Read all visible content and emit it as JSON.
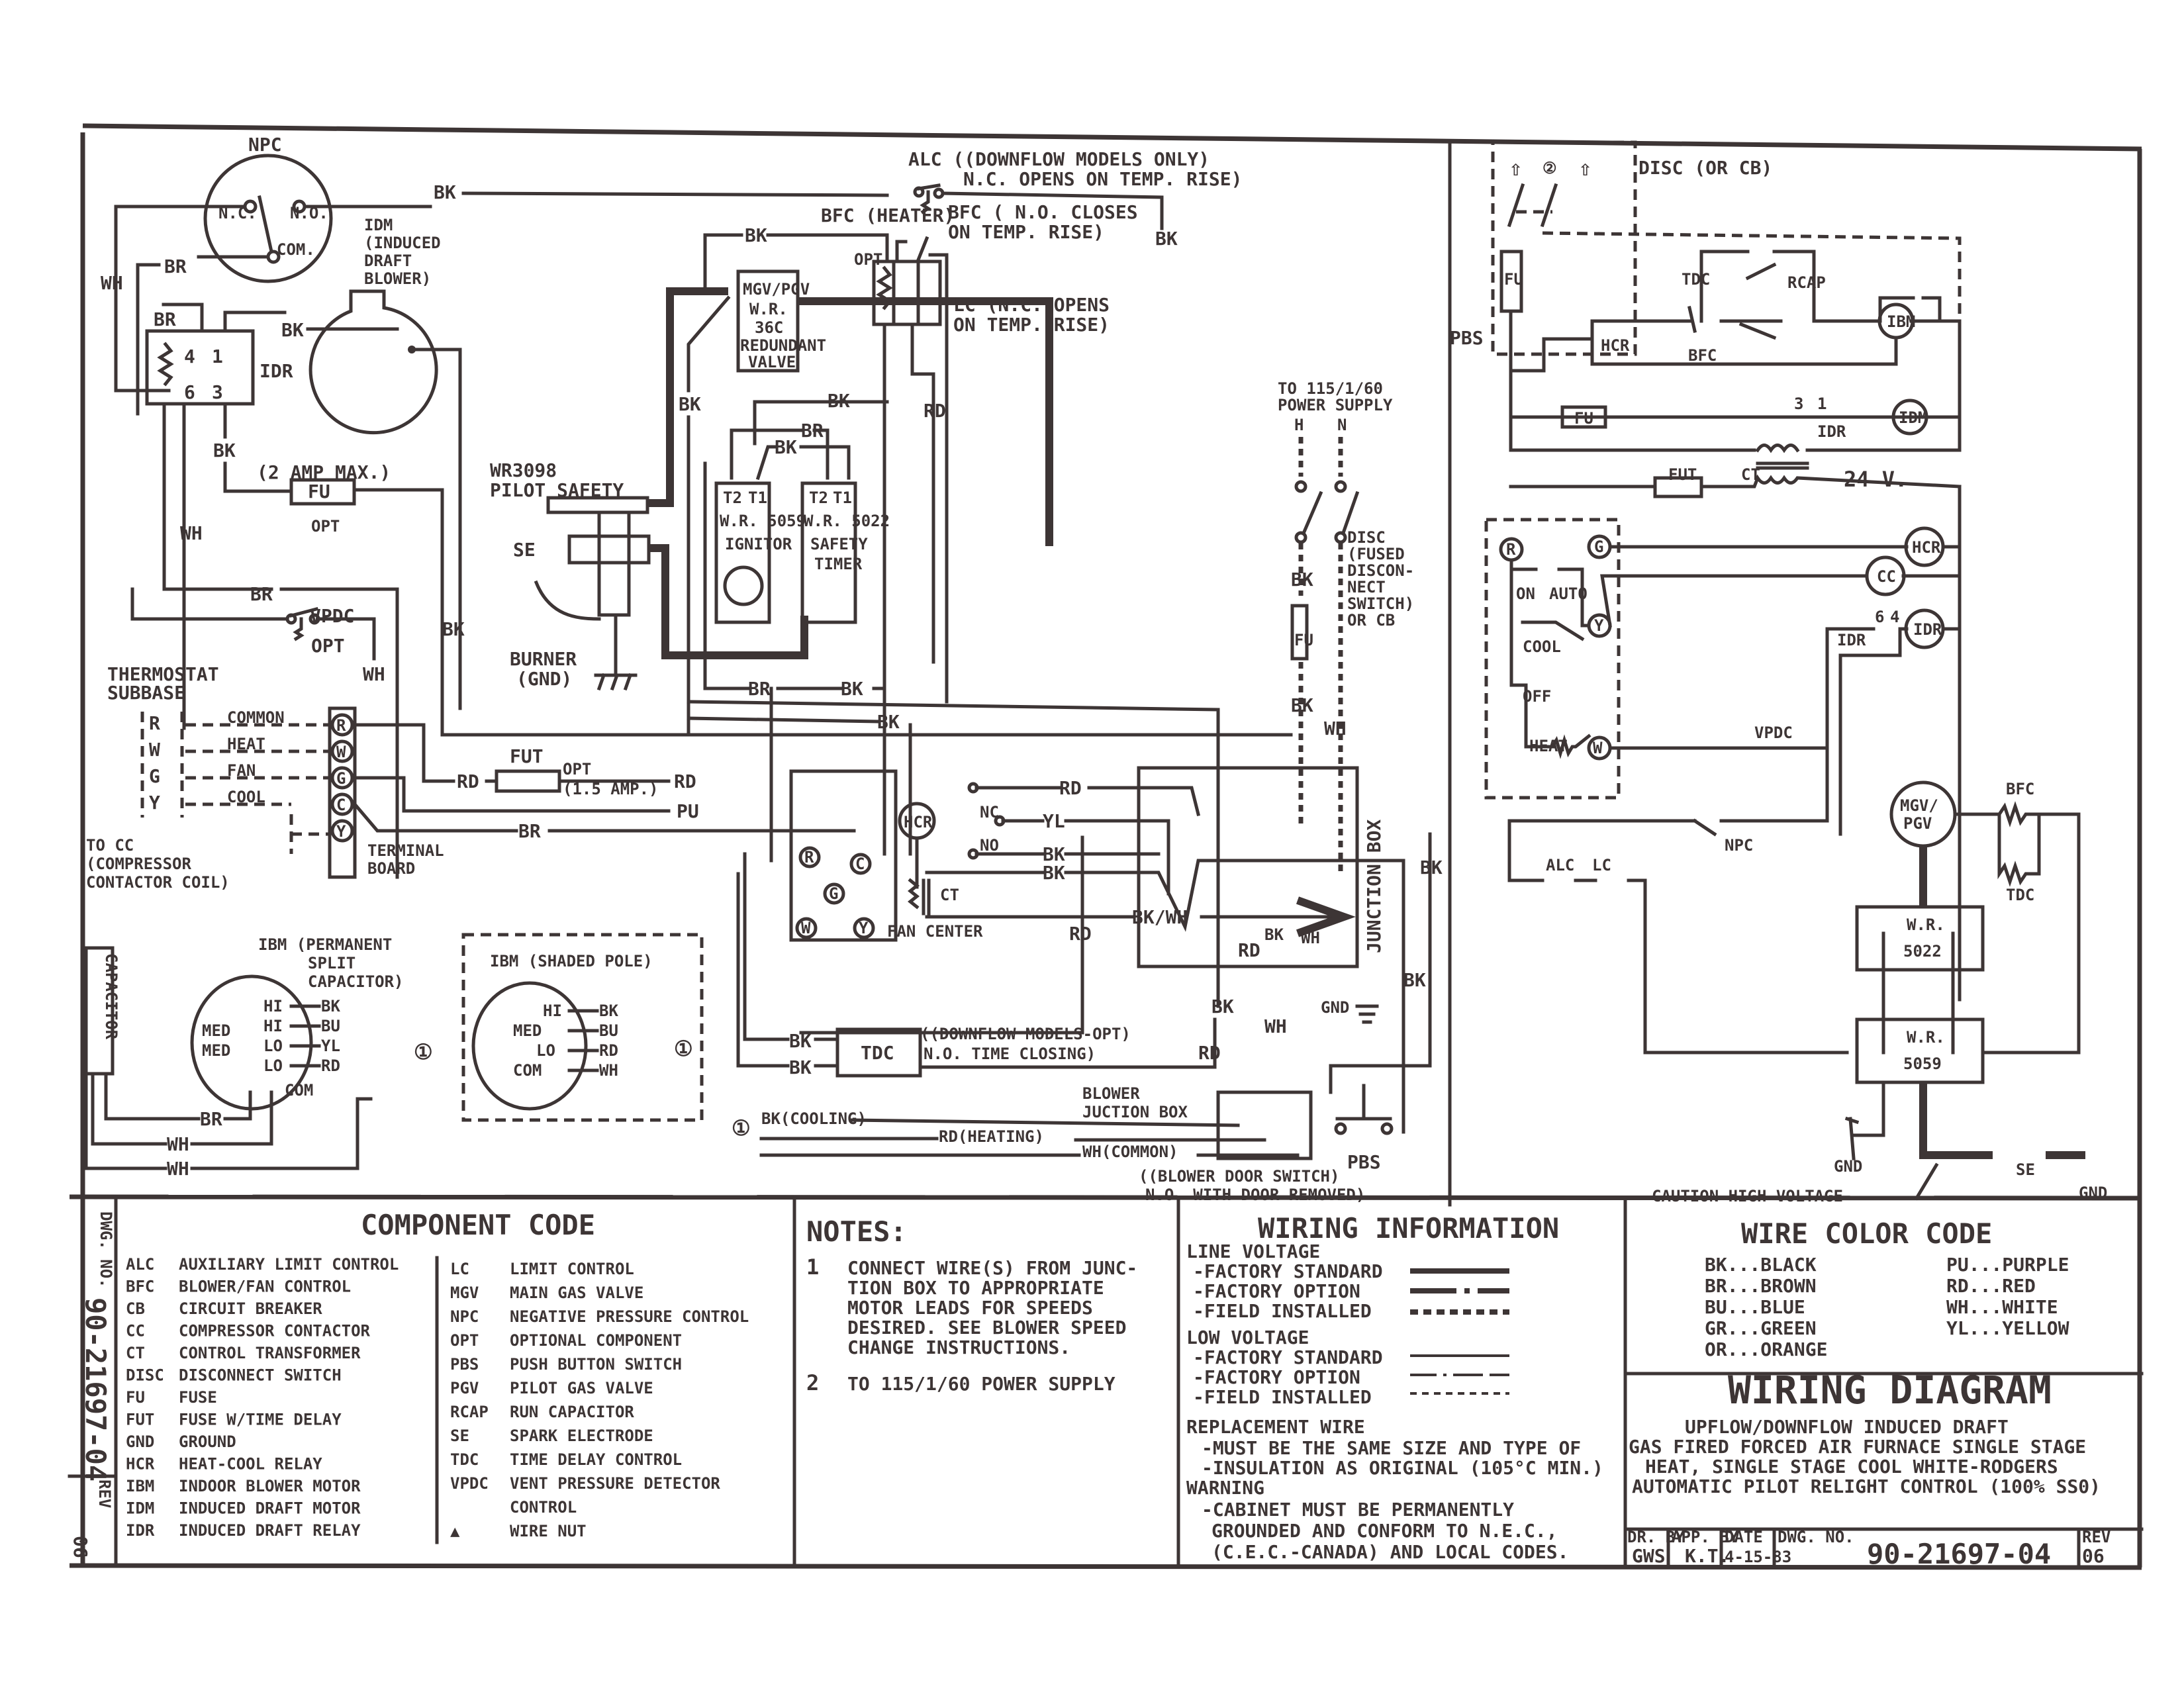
{
  "document": {
    "drawing_number": "90-21697-04",
    "rev": "06",
    "dwg_no_label": "DWG. NO.",
    "rev_label": "REV"
  },
  "schematic": {
    "npc": {
      "title": "NPC",
      "nc": "N.C.",
      "no": "N.O.",
      "com": "COM."
    },
    "idm_label": [
      "IDM",
      "(INDUCED",
      "DRAFT",
      "BLOWER)"
    ],
    "idr_label": "IDR",
    "idr_pins": [
      "4",
      "1",
      "6",
      "3"
    ],
    "alc_label": [
      "ALC  ((DOWNFLOW MODELS ONLY)",
      "N.C. OPENS ON TEMP. RISE)"
    ],
    "bfc_heater": "BFC (HEATER)",
    "bfc_closes": [
      "BFC ( N.O. CLOSES",
      "ON TEMP. RISE)"
    ],
    "lc_opens": [
      "LC (N.C. OPENS",
      "ON TEMP. RISE)"
    ],
    "opt": "OPT",
    "mgv_box": [
      "MGV/PGV",
      "W.R.",
      "36C",
      "REDUNDANT",
      "VALVE"
    ],
    "two_amp": "(2 AMP MAX.)",
    "fu": "FU",
    "pilot_safety": [
      "WR3098",
      "PILOT SAFETY"
    ],
    "se": "SE",
    "burner": [
      "BURNER",
      "(GND)"
    ],
    "ignitor_box": [
      "T2",
      "T1",
      "W.R. 5059",
      "IGNITOR"
    ],
    "timer_box": [
      "T2",
      "T1",
      "W.R. 5022",
      "SAFETY",
      "TIMER"
    ],
    "power_supply": [
      "TO 115/1/60",
      "POWER SUPPLY",
      "H",
      "N"
    ],
    "disc_fused": [
      "DISC",
      "(FUSED",
      "DISCON-",
      "NECT",
      "SWITCH)",
      "OR CB"
    ],
    "vpdc": [
      "VPDC",
      "OPT"
    ],
    "thermostat": [
      "THERMOSTAT",
      "SUBBASE"
    ],
    "subbase_terms": [
      {
        "letter": "R",
        "name": "COMMON"
      },
      {
        "letter": "W",
        "name": "HEAT"
      },
      {
        "letter": "G",
        "name": "FAN"
      },
      {
        "letter": "Y",
        "name": "COOL"
      }
    ],
    "terminal_board_terms": [
      "R",
      "W",
      "G",
      "C",
      "Y"
    ],
    "terminal_board": [
      "TERMINAL",
      "BOARD"
    ],
    "to_cc": [
      "TO CC",
      "(COMPRESSOR",
      "CONTACTOR COIL)"
    ],
    "fut": [
      "FUT",
      "OPT",
      "(1.5 AMP.)"
    ],
    "fan_center": {
      "label": "FAN CENTER",
      "terms": [
        "R",
        "C",
        "G",
        "W",
        "Y"
      ],
      "hcr": "HCR",
      "ct": "CT",
      "nc": "NC",
      "no": "NO"
    },
    "tdc": {
      "label": "TDC",
      "note": [
        "((DOWNFLOW MODELS-OPT)",
        "N.O. TIME CLOSING)"
      ]
    },
    "junction_box": "JUNCTION BOX",
    "gnd": "GND",
    "blower_jb": [
      "BLOWER",
      "JUCTION BOX"
    ],
    "speed_leads": [
      "BK(COOLING)",
      "RD(HEATING)",
      "WH(COMMON)"
    ],
    "door_switch": [
      "((BLOWER DOOR SWITCH)",
      "N.O. WITH DOOR REMOVED)"
    ],
    "pbs": "PBS",
    "capacitor": "CAPACITOR",
    "ibm_psc": {
      "title": [
        "IBM (PERMANENT",
        "SPLIT",
        "CAPACITOR)"
      ],
      "taps": [
        "HI",
        "HI",
        "LO",
        "LO"
      ],
      "side": [
        "MED",
        "MED"
      ],
      "leads": [
        "BK",
        "BU",
        "YL",
        "RD"
      ],
      "com": "COM"
    },
    "ibm_sp": {
      "title": "IBM (SHADED POLE)",
      "taps": [
        "HI",
        "MED",
        "LO",
        "COM"
      ],
      "leads": [
        "BK",
        "BU",
        "RD",
        "WH"
      ]
    },
    "wire_labels": {
      "bk": "BK",
      "br": "BR",
      "wh": "WH",
      "rd": "RD",
      "pu": "PU",
      "yl": "YL",
      "bkwh": "BK/WH"
    }
  },
  "ladder": {
    "disc": "DISC (OR CB)",
    "note2": "2",
    "fu": "FU",
    "pbs": "PBS",
    "tdc": "TDC",
    "rcap": "RCAP",
    "ibm": "IBM",
    "hcr": "HCR",
    "bfc": "BFC",
    "idr_pins": [
      "3",
      "1"
    ],
    "idr": "IDR",
    "idm": "IDM",
    "fut": "FUT",
    "ct": "CT",
    "volt": "24 V.",
    "stat": {
      "r": "R",
      "on": "ON",
      "auto": "AUTO",
      "g": "G",
      "y": "Y",
      "cool": "COOL",
      "off": "OFF",
      "heat": "HEAT",
      "w": "W"
    },
    "cc": "CC",
    "idr_contact": [
      "6",
      "4"
    ],
    "vpdc": "VPDC",
    "npc": "NPC",
    "mgv": [
      "MGV/",
      "PGV"
    ],
    "bfc2": "BFC",
    "tdc2": "TDC",
    "alc": "ALC",
    "lc": "LC",
    "wr5022": [
      "W.R.",
      "5022"
    ],
    "wr5059": [
      "W.R.",
      "5059"
    ],
    "gnd": "GND",
    "se": "SE",
    "caution": "CAUTION-HIGH VOLTAGE"
  },
  "component_code": {
    "title": "COMPONENT CODE",
    "left": [
      {
        "code": "ALC",
        "desc": "AUXILIARY LIMIT CONTROL"
      },
      {
        "code": "BFC",
        "desc": "BLOWER/FAN CONTROL"
      },
      {
        "code": "CB",
        "desc": "CIRCUIT BREAKER"
      },
      {
        "code": "CC",
        "desc": "COMPRESSOR CONTACTOR"
      },
      {
        "code": "CT",
        "desc": "CONTROL TRANSFORMER"
      },
      {
        "code": "DISC",
        "desc": "DISCONNECT SWITCH"
      },
      {
        "code": "FU",
        "desc": "FUSE"
      },
      {
        "code": "FUT",
        "desc": "FUSE W/TIME DELAY"
      },
      {
        "code": "GND",
        "desc": "GROUND"
      },
      {
        "code": "HCR",
        "desc": "HEAT-COOL RELAY"
      },
      {
        "code": "IBM",
        "desc": "INDOOR BLOWER MOTOR"
      },
      {
        "code": "IDM",
        "desc": "INDUCED DRAFT MOTOR"
      },
      {
        "code": "IDR",
        "desc": "INDUCED DRAFT RELAY"
      }
    ],
    "right": [
      {
        "code": "LC",
        "desc": "LIMIT CONTROL"
      },
      {
        "code": "MGV",
        "desc": "MAIN GAS VALVE"
      },
      {
        "code": "NPC",
        "desc": "NEGATIVE PRESSURE CONTROL"
      },
      {
        "code": "OPT",
        "desc": "OPTIONAL COMPONENT"
      },
      {
        "code": "PBS",
        "desc": "PUSH BUTTON SWITCH"
      },
      {
        "code": "PGV",
        "desc": "PILOT GAS VALVE"
      },
      {
        "code": "RCAP",
        "desc": "RUN CAPACITOR"
      },
      {
        "code": "SE",
        "desc": "SPARK ELECTRODE"
      },
      {
        "code": "TDC",
        "desc": "TIME DELAY CONTROL"
      },
      {
        "code": "VPDC",
        "desc": "VENT PRESSURE DETECTOR"
      },
      {
        "code": "",
        "desc": "CONTROL"
      },
      {
        "code": "▲",
        "desc": "WIRE NUT"
      }
    ]
  },
  "notes": {
    "title": "NOTES:",
    "items": [
      {
        "num": "1",
        "lines": [
          "CONNECT WIRE(S) FROM JUNC-",
          "TION BOX TO APPROPRIATE",
          "MOTOR LEADS FOR SPEEDS",
          "DESIRED. SEE BLOWER SPEED",
          "CHANGE INSTRUCTIONS."
        ]
      },
      {
        "num": "2",
        "lines": [
          "TO 115/1/60 POWER SUPPLY"
        ]
      }
    ]
  },
  "wiring_info": {
    "title": "WIRING INFORMATION",
    "line_voltage": "LINE VOLTAGE",
    "low_voltage": "LOW VOLTAGE",
    "rows": [
      "-FACTORY STANDARD",
      "-FACTORY OPTION",
      "-FIELD INSTALLED"
    ],
    "replacement": "REPLACEMENT WIRE",
    "replacement_lines": [
      "-MUST BE THE SAME SIZE AND TYPE OF",
      "-INSULATION AS ORIGINAL (105°C MIN.)"
    ],
    "warning": "WARNING",
    "warning_lines": [
      "-CABINET MUST BE PERMANENTLY",
      "GROUNDED AND CONFORM TO N.E.C.,",
      "(C.E.C.-CANADA) AND LOCAL CODES."
    ]
  },
  "wire_color_code": {
    "title": "WIRE COLOR CODE",
    "left": [
      "BK...BLACK",
      "BR...BROWN",
      "BU...BLUE",
      "GR...GREEN",
      "OR...ORANGE"
    ],
    "right": [
      "PU...PURPLE",
      "RD...RED",
      "WH...WHITE",
      "YL...YELLOW"
    ]
  },
  "title_block": {
    "title": "WIRING DIAGRAM",
    "subtitle": [
      "UPFLOW/DOWNFLOW INDUCED DRAFT",
      "GAS FIRED FORCED AIR FURNACE SINGLE STAGE",
      "HEAT, SINGLE STAGE COOL WHITE-RODGERS",
      "AUTOMATIC PILOT RELIGHT CONTROL (100% SS0)"
    ],
    "fields": [
      {
        "label": "DR. BY",
        "value": "GWS"
      },
      {
        "label": "APP. BY",
        "value": "K.T."
      },
      {
        "label": "DATE",
        "value": "4-15-83"
      },
      {
        "label": "DWG. NO.",
        "value": "90-21697-04"
      },
      {
        "label": "REV",
        "value": "06"
      }
    ]
  }
}
